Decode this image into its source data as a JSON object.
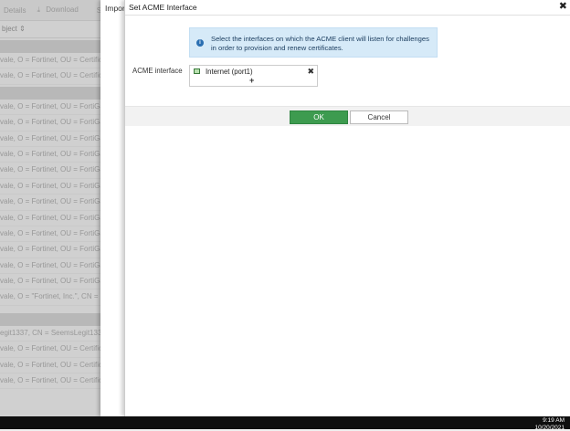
{
  "background": {
    "toolbar": {
      "details": "Details",
      "download": "Download",
      "partial": "Se"
    },
    "column_header": "bject",
    "group1_rows": [
      "vale, O = Fortinet, OU = Certificat",
      "vale, O = Fortinet, OU = Certificat"
    ],
    "group2_rows": [
      "vale, O = Fortinet, OU = FortiGat",
      "vale, O = Fortinet, OU = FortiGat",
      "vale, O = Fortinet, OU = FortiGat",
      "vale, O = Fortinet, OU = FortiGat",
      "vale, O = Fortinet, OU = FortiGat",
      "vale, O = Fortinet, OU = FortiGat",
      "vale, O = Fortinet, OU = FortiGat",
      "vale, O = Fortinet, OU = FortiGat",
      "vale, O = Fortinet, OU = FortiGat",
      "vale, O = Fortinet, OU = FortiGat",
      "vale, O = Fortinet, OU = FortiGat",
      "vale, O = Fortinet, OU = FortiGat",
      "vale, O = \"Fortinet, Inc.\", CN = aut"
    ],
    "group3_rows": [
      "egit1337, CN = SeemsLegit1337C",
      "vale, O = Fortinet, OU = Certificat",
      "vale, O = Fortinet, OU = Certificat",
      "vale, O = Fortinet, OU = Certificat"
    ]
  },
  "outer_panel": {
    "title": "Impor"
  },
  "dialog": {
    "title": "Set ACME Interface",
    "info_text": "Select the interfaces on which the ACME client will listen for challenges in order to provision and renew certificates.",
    "field_label": "ACME interface",
    "interface_item": "Internet (port1)",
    "ok_label": "OK",
    "cancel_label": "Cancel"
  },
  "icons": {
    "info": "info-icon",
    "close": "close-icon",
    "port": "network-port-icon",
    "remove": "remove-icon",
    "add": "plus-icon"
  },
  "colors": {
    "ok_button": "#3d9b4f",
    "info_background": "#d6eaf8"
  },
  "taskbar": {
    "time": "9:19 AM",
    "date": "10/20/2021"
  }
}
